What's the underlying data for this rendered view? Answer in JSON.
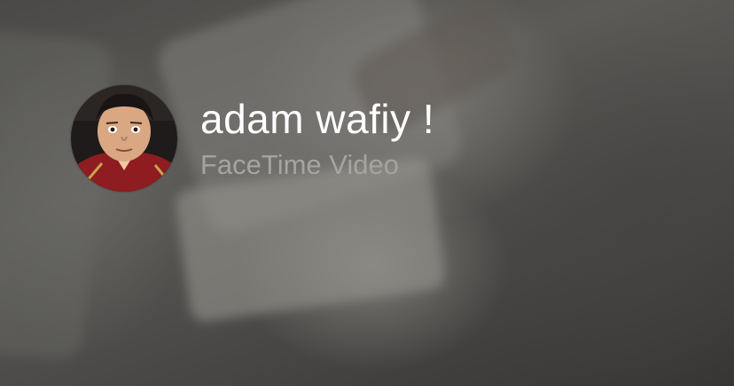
{
  "call": {
    "caller_name": "adam wafiy !",
    "call_type": "FaceTime Video"
  },
  "icons": {
    "avatar": "contact-photo"
  },
  "colors": {
    "name_text": "#ffffff",
    "subtitle_text": "#a6a4a1",
    "background": "#4a4947"
  }
}
